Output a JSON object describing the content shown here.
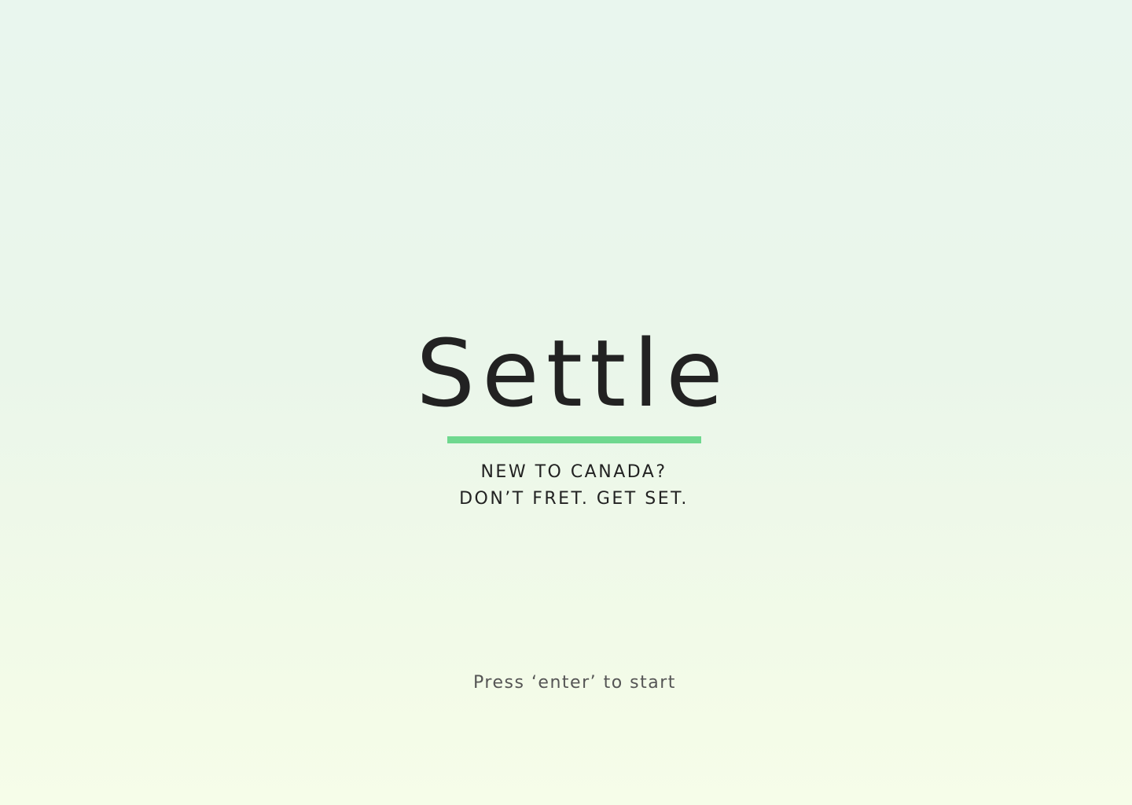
{
  "app": {
    "logo_text": "Settle",
    "accent_color": "#6fd88f"
  },
  "tagline": {
    "line1": "NEW TO CANADA?",
    "line2": "DON’T FRET. GET SET."
  },
  "prompt": {
    "text": "Press ‘enter’ to start"
  }
}
